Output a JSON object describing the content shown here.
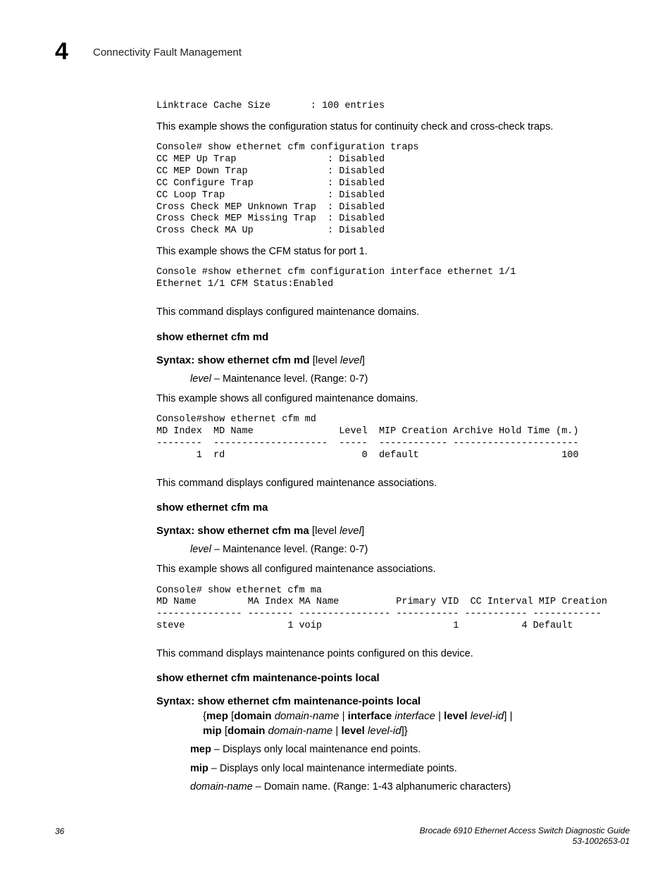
{
  "chapter": {
    "number": "4",
    "title": "Connectivity Fault Management"
  },
  "linktrace_line": "Linktrace Cache Size       : 100 entries",
  "para_traps": "This example shows the configuration status for continuity check and cross-check traps.",
  "traps_output": "Console# show ethernet cfm configuration traps\nCC MEP Up Trap                : Disabled\nCC MEP Down Trap              : Disabled\nCC Configure Trap             : Disabled\nCC Loop Trap                  : Disabled\nCross Check MEP Unknown Trap  : Disabled\nCross Check MEP Missing Trap  : Disabled\nCross Check MA Up             : Disabled",
  "para_port1": "This example shows the CFM status for port 1.",
  "port1_output": "Console #show ethernet cfm configuration interface ethernet 1/1\nEthernet 1/1 CFM Status:Enabled",
  "para_cmd_md": "This command displays configured maintenance domains.",
  "cmd_md": "show ethernet cfm md",
  "syntax_label": "Syntax:  ",
  "syntax_md_bold": "show ethernet cfm md",
  "syntax_md_rest_bold": " [level ",
  "syntax_md_italic": "level",
  "syntax_md_close": "]",
  "level_param_italic": "level",
  "level_param_desc": " – Maintenance level. (Range: 0-7)",
  "para_example_md": "This example shows all configured maintenance domains.",
  "md_output": "Console#show ethernet cfm md\nMD Index  MD Name               Level  MIP Creation Archive Hold Time (m.)\n--------  --------------------  -----  ------------ ----------------------\n       1  rd                        0  default                         100",
  "para_cmd_ma": "This command displays configured maintenance associations.",
  "cmd_ma": "show ethernet cfm ma",
  "syntax_ma_bold": "show ethernet cfm ma",
  "para_example_ma": "This example shows all configured maintenance associations.",
  "ma_output": "Console# show ethernet cfm ma\nMD Name         MA Index MA Name          Primary VID  CC Interval MIP Creation\n--------------- -------- ---------------- ----------- ----------- ------------\nsteve                  1 voip                       1           4 Default",
  "para_cmd_mp": "This command displays maintenance points configured on this device.",
  "cmd_mp": "show ethernet cfm maintenance-points local",
  "syntax_mp_line1": "show ethernet cfm maintenance-points local",
  "syntax_mp_mep": "mep",
  "syntax_mp_domain": "domain",
  "syntax_mp_domainname": "domain-name",
  "syntax_mp_interface": "interface",
  "syntax_mp_interfaceital": "interface",
  "syntax_mp_level": "level",
  "syntax_mp_levelid": "level-id",
  "syntax_mp_mip": "mip",
  "param_mep_bold": "mep",
  "param_mep_desc": " – Displays only local maintenance end points.",
  "param_mip_bold": "mip",
  "param_mip_desc": " – Displays only local maintenance intermediate points.",
  "param_domain_italic": "domain-name",
  "param_domain_desc": " – Domain name. (Range: 1-43 alphanumeric characters)",
  "footer": {
    "page": "36",
    "doc_line1": "Brocade 6910 Ethernet Access Switch Diagnostic Guide",
    "doc_line2": "53-1002653-01"
  }
}
